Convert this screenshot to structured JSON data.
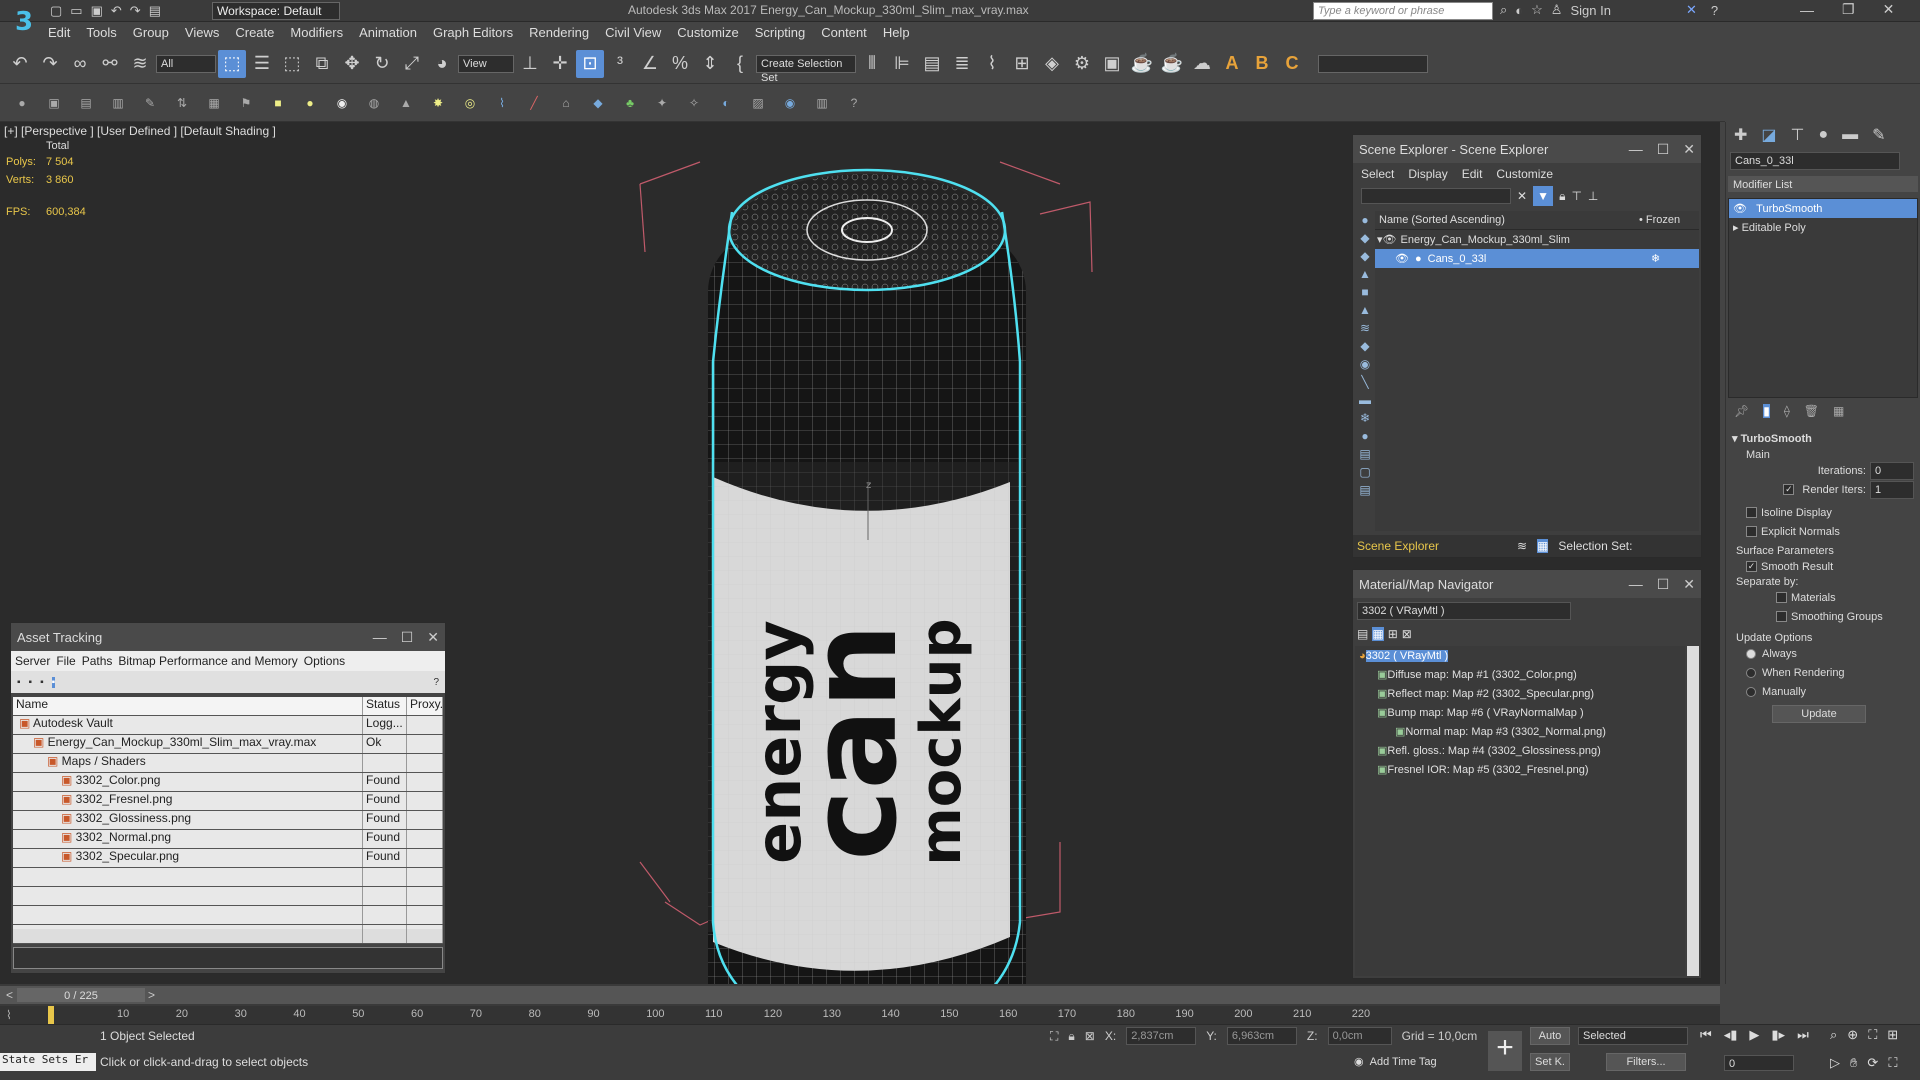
{
  "app": {
    "window_title": "Autodesk 3ds Max 2017     Energy_Can_Mockup_330ml_Slim_max_vray.max",
    "workspace": "Workspace: Default",
    "search_placeholder": "Type a keyword or phrase",
    "sign_in": "Sign In"
  },
  "menu": [
    "Edit",
    "Tools",
    "Group",
    "Views",
    "Create",
    "Modifiers",
    "Animation",
    "Graph Editors",
    "Rendering",
    "Civil View",
    "Customize",
    "Scripting",
    "Content",
    "Help"
  ],
  "toolbar": {
    "filter": "All",
    "view": "View",
    "selection_set": "Create Selection Set",
    "icons": [
      "undo-icon",
      "redo-icon",
      "link-icon",
      "unlink-icon",
      "bind-space-warp-icon",
      "select-icon",
      "select-by-name-icon",
      "rect-region-icon",
      "window-crossing-icon",
      "move-icon",
      "rotate-icon",
      "scale-icon",
      "place-icon",
      "pivot-icon",
      "select-manipulate-icon",
      "keyboard-shortcut-icon",
      "snap-3d-icon",
      "angle-snap-icon",
      "percent-snap-icon",
      "spinner-snap-icon",
      "edit-named-sets-icon",
      "mirror-icon",
      "align-icon",
      "layer-explorer-icon",
      "toggle-ribbon-icon",
      "curve-editor-icon",
      "schematic-view-icon",
      "material-editor-icon",
      "render-setup-icon",
      "rendered-frame-icon",
      "render-icon",
      "render-iterative-icon",
      "render-cloud-icon",
      "text-a-icon",
      "text-b-icon",
      "text-c-icon"
    ]
  },
  "viewport": {
    "label": "[+] [Perspective ]  [User Defined ]  [Default Shading ]",
    "stats_header": "Total",
    "polys_label": "Polys:",
    "polys": "7 504",
    "verts_label": "Verts:",
    "verts": "3 860",
    "fps_label": "FPS:",
    "fps": "600,384",
    "can_text_1": "energy",
    "can_text_2": "can",
    "can_text_3": "mockup",
    "gizmo_label": "z"
  },
  "scene_explorer": {
    "title": "Scene Explorer - Scene Explorer",
    "menu": [
      "Select",
      "Display",
      "Edit",
      "Customize"
    ],
    "col_name": "Name (Sorted Ascending)",
    "col_frozen": "• Frozen",
    "items": [
      {
        "label": "Energy_Can_Mockup_330ml_Slim",
        "selected": false
      },
      {
        "label": "Cans_0_33l",
        "selected": true
      }
    ],
    "footer_left": "Scene Explorer",
    "footer_right": "Selection Set:"
  },
  "material_nav": {
    "title": "Material/Map Navigator",
    "field": "3302  ( VRayMtl )",
    "items": [
      {
        "label": "3302  ( VRayMtl )",
        "selected": true,
        "indent": 0
      },
      {
        "label": "Diffuse map: Map #1 (3302_Color.png)",
        "selected": false,
        "indent": 1
      },
      {
        "label": "Reflect map: Map #2 (3302_Specular.png)",
        "selected": false,
        "indent": 1
      },
      {
        "label": "Bump map: Map #6  ( VRayNormalMap )",
        "selected": false,
        "indent": 1
      },
      {
        "label": "Normal map: Map #3 (3302_Normal.png)",
        "selected": false,
        "indent": 2
      },
      {
        "label": "Refl. gloss.: Map #4 (3302_Glossiness.png)",
        "selected": false,
        "indent": 1
      },
      {
        "label": "Fresnel IOR: Map #5 (3302_Fresnel.png)",
        "selected": false,
        "indent": 1
      }
    ]
  },
  "asset_tracking": {
    "title": "Asset Tracking",
    "menu": [
      "Server",
      "File",
      "Paths",
      "Bitmap Performance and Memory",
      "Options"
    ],
    "columns": [
      "Name",
      "Status",
      "Proxy..."
    ],
    "rows": [
      {
        "name": "Autodesk Vault",
        "status": "Logg...",
        "indent": 0
      },
      {
        "name": "Energy_Can_Mockup_330ml_Slim_max_vray.max",
        "status": "Ok",
        "indent": 1
      },
      {
        "name": "Maps / Shaders",
        "status": "",
        "indent": 2
      },
      {
        "name": "3302_Color.png",
        "status": "Found",
        "indent": 3
      },
      {
        "name": "3302_Fresnel.png",
        "status": "Found",
        "indent": 3
      },
      {
        "name": "3302_Glossiness.png",
        "status": "Found",
        "indent": 3
      },
      {
        "name": "3302_Normal.png",
        "status": "Found",
        "indent": 3
      },
      {
        "name": "3302_Specular.png",
        "status": "Found",
        "indent": 3
      }
    ]
  },
  "command_panel": {
    "object_name": "Cans_0_33l",
    "modifier_list": "Modifier List",
    "stack": [
      {
        "label": "TurboSmooth",
        "selected": true
      },
      {
        "label": "Editable Poly",
        "selected": false
      }
    ],
    "rollout_title": "TurboSmooth",
    "main_label": "Main",
    "iterations_label": "Iterations:",
    "iterations": "0",
    "render_iters_label": "Render Iters:",
    "render_iters": "1",
    "isoline": "Isoline Display",
    "explicit_normals": "Explicit Normals",
    "surface_params": "Surface Parameters",
    "smooth_result": "Smooth Result",
    "separate_by": "Separate by:",
    "materials": "Materials",
    "smoothing_groups": "Smoothing Groups",
    "update_options": "Update Options",
    "always": "Always",
    "when_rendering": "When Rendering",
    "manually": "Manually",
    "update_btn": "Update"
  },
  "timeline": {
    "frame": "0 / 225",
    "ticks": [
      "10",
      "20",
      "30",
      "40",
      "50",
      "60",
      "70",
      "80",
      "90",
      "100",
      "110",
      "120",
      "130",
      "140",
      "150",
      "160",
      "170",
      "180",
      "190",
      "200",
      "210",
      "220"
    ]
  },
  "status": {
    "maxscript": "State Sets Er",
    "selected": "1 Object Selected",
    "prompt": "Click or click-and-drag to select objects",
    "x_label": "X:",
    "x": "2,837cm",
    "y_label": "Y:",
    "y": "6,963cm",
    "z_label": "Z:",
    "z": "0,0cm",
    "grid": "Grid = 10,0cm",
    "add_time_tag": "Add Time Tag",
    "auto": "Auto",
    "selected_dd": "Selected",
    "set_k": "Set K.",
    "filters": "Filters...",
    "frame_field": "0"
  }
}
